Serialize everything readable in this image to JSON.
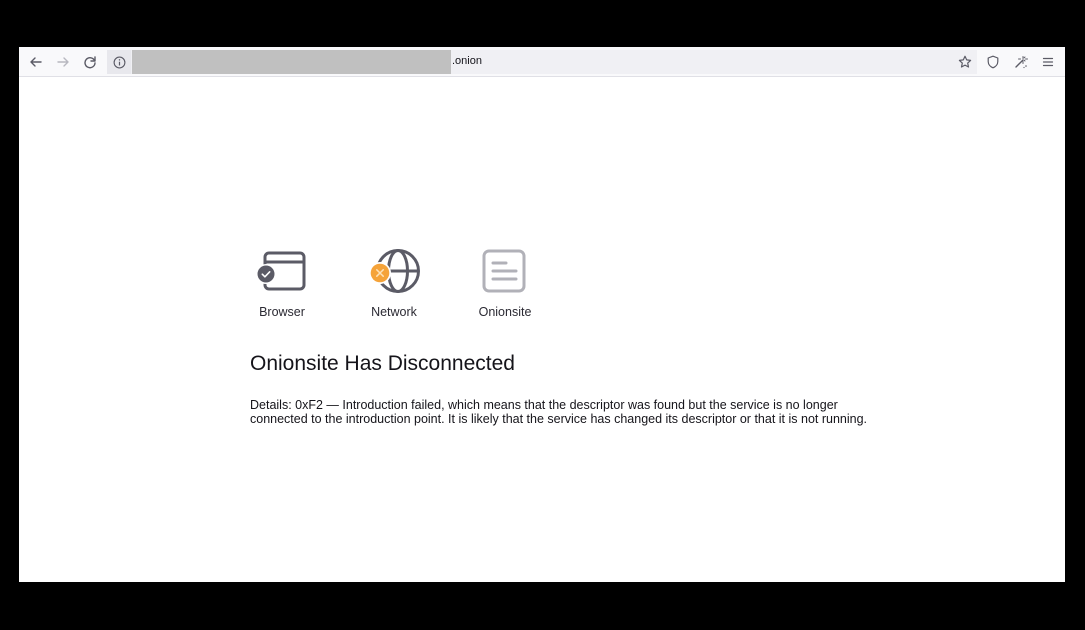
{
  "toolbar": {
    "back_icon": "arrow-left-icon",
    "forward_icon": "arrow-right-icon",
    "reload_icon": "reload-icon",
    "site_info_icon": "info-circle-icon",
    "url_visible": ".onion",
    "bookmark_icon": "star-icon",
    "shield_icon": "shield-icon",
    "extension_icon": "magic-wand-icon",
    "menu_icon": "hamburger-menu-icon"
  },
  "status": {
    "items": [
      {
        "label": "Browser",
        "state": "ok",
        "badge_color": "#5b5b66"
      },
      {
        "label": "Network",
        "state": "error",
        "badge_color": "#f5a339"
      },
      {
        "label": "Onionsite",
        "state": "inactive"
      }
    ]
  },
  "error": {
    "title": "Onionsite Has Disconnected",
    "details": "Details: 0xF2 — Introduction failed, which means that the descriptor was found but the service is no longer connected to the introduction point. It is likely that the service has changed its descriptor or that it is not running."
  }
}
